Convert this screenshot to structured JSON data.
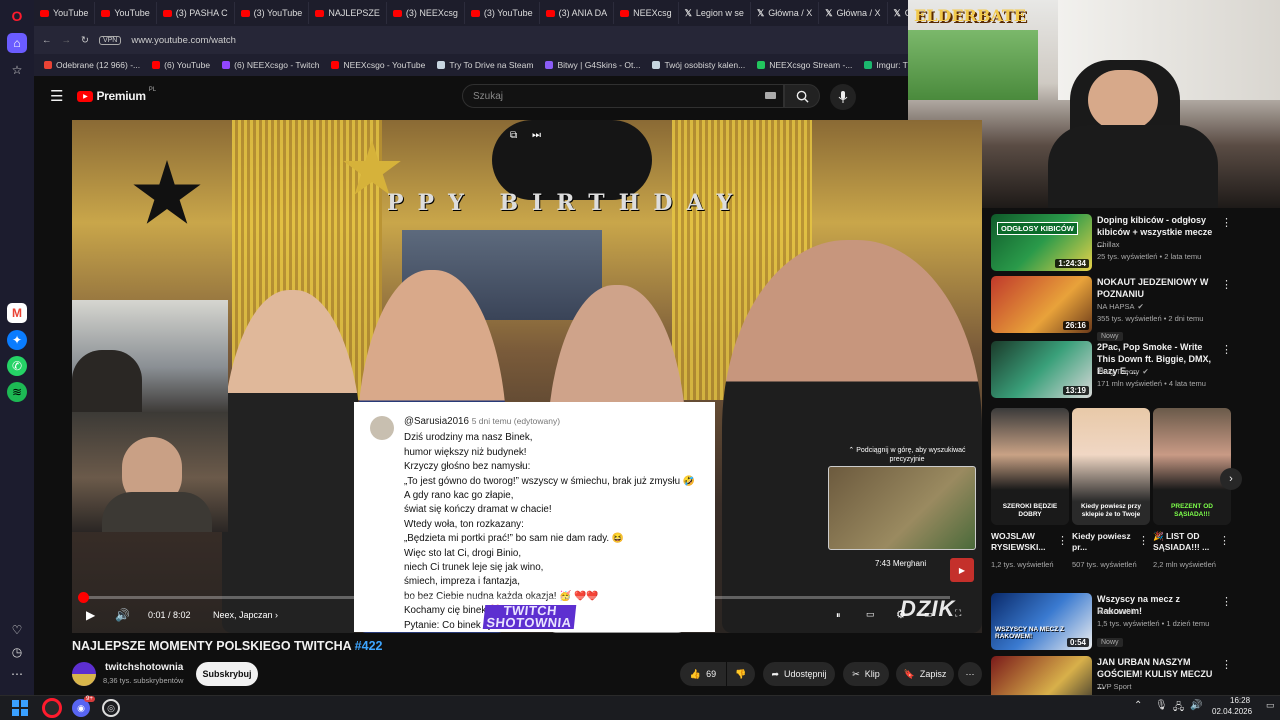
{
  "browser": {
    "tabs": [
      {
        "label": "YouTube",
        "kind": "yt"
      },
      {
        "label": "YouTube",
        "kind": "yt"
      },
      {
        "label": "(3) PASHA C",
        "kind": "yt"
      },
      {
        "label": "(3) YouTube",
        "kind": "yt"
      },
      {
        "label": "NAJLEPSZE",
        "kind": "yt"
      },
      {
        "label": "(3) NEEXcsg",
        "kind": "yt"
      },
      {
        "label": "(3) YouTube",
        "kind": "yt"
      },
      {
        "label": "(3) ANIA DA",
        "kind": "yt"
      },
      {
        "label": "NEEXcsg",
        "kind": "yt"
      },
      {
        "label": "Legion w se",
        "kind": "x"
      },
      {
        "label": "Główna / X",
        "kind": "x"
      },
      {
        "label": "Główna / X",
        "kind": "x"
      },
      {
        "label": "Główna / X",
        "kind": "x"
      }
    ],
    "vpn_label": "VPN",
    "url": "www.youtube.com/watch",
    "bookmarks": [
      {
        "label": "Odebrane (12 966) -...",
        "color": "#ea4335"
      },
      {
        "label": "(6) YouTube",
        "color": "#ff0000"
      },
      {
        "label": "(6) NEEXcsgo - Twitch",
        "color": "#9146ff"
      },
      {
        "label": "NEEXcsgo - YouTube",
        "color": "#ff0000"
      },
      {
        "label": "Try To Drive na Steam",
        "color": "#c7d5e0"
      },
      {
        "label": "Bitwy | G4Skins - Ot...",
        "color": "#8a5cf6"
      },
      {
        "label": "Twój osobisty kalen...",
        "color": "#c7d5e0"
      },
      {
        "label": "NEEXcsgo Stream -...",
        "color": "#22c55e"
      },
      {
        "label": "Imgur: The magic of...",
        "color": "#1bb76e"
      }
    ]
  },
  "header": {
    "logo": "Premium",
    "logo_sup": "PL",
    "search_placeholder": "Szukaj"
  },
  "video": {
    "banner": "PPY  BIRTHDAY",
    "comment": {
      "username": "@Sarusia2016",
      "date": "5 dni temu (edytowany)",
      "lines": [
        "Dziś urodziny ma nasz Binek,",
        "humor większy niż budynek!",
        "Krzyczy głośno bez namysłu:",
        "„To jest gówno do tworog!” wszyscy w śmiechu, brak już zmysłu 🤣",
        "A gdy rano kac go złapie,",
        "świat się kończy dramat w chacie!",
        "Wtedy woła, ton rozkazany:",
        "„Będzieta mi portki prać!” bo sam nie dam rady. 😆",
        "Więc sto lat Ci, drogi Binio,",
        "niech Ci trunek leje się jak wino,",
        "śmiech, impreza i fantazja,",
        "bo bez Ciebie nudna każda okazja! 🥳 ❤️❤️",
        "Kochamy cię binek ❤️",
        "Pytanie: Co binek zje na obiad ?"
      ]
    },
    "overlay_brand_1": "TWITCH",
    "overlay_brand_2": "SHOTOWNIA",
    "watermark": "DZIK",
    "seek_hint": "Podciągnij w górę, aby wyszukiwać precyzyjnie",
    "preview_time": "7:43",
    "preview_label": "Merghani",
    "time_current": "0:01",
    "time_total": "8:02",
    "chapter": "Neex, Japczan",
    "progress": 0.003
  },
  "meta": {
    "title": "NAJLEPSZE MOMENTY POLSKIEGO TWITCHA",
    "title_tag": "#422",
    "channel": "twitchshotownia",
    "subscribers": "8,36 tys. subskrybentów",
    "subscribe_label": "Subskrybuj",
    "likes": "69",
    "share_label": "Udostępnij",
    "clip_label": "Klip",
    "save_label": "Zapisz"
  },
  "recommendations": [
    {
      "title": "Doping kibiców - odgłosy kibiców + wszystkie mecze ...",
      "channel": "Chillax",
      "meta": "25 tys. wyświetleń • 2 lata temu",
      "duration": "1:24:34",
      "thumb_text": "ODGŁOSY KIBICÓW",
      "new": false,
      "verified": false
    },
    {
      "title": "NOKAUT JEDZENIOWY W POZNANIU",
      "channel": "NA HAPSA",
      "meta": "355 tys. wyświetleń • 2 dni temu",
      "duration": "26:16",
      "thumb_text": "",
      "new": true,
      "verified": true
    },
    {
      "title": "2Pac, Pop Smoke - Write This Down ft. Biggie, DMX, Eazy E, ...",
      "channel": "Thug Theory",
      "meta": "171 mln wyświetleń • 4 lata temu",
      "duration": "13:19",
      "thumb_text": "",
      "new": false,
      "verified": true
    }
  ],
  "shorts": [
    {
      "title": "WOJSLAW RYSIEWSKI...",
      "views": "1,2 tys. wyświetleń",
      "caption": "SZEROKI BĘDZIE DOBRY"
    },
    {
      "title": "Kiedy powiesz pr...",
      "views": "507 tys. wyświetleń",
      "caption": "Kiedy powiesz przy sklepie że to Twoje"
    },
    {
      "title": "🎉 LIST OD SĄSIADA!!! ...",
      "views": "2,2 mln wyświetleń",
      "caption": "PREZENT OD SĄSIADA!!!"
    }
  ],
  "recommendations_2": [
    {
      "title": "Wszyscy na mecz z Rakowem!",
      "channel": "Motor Lublin",
      "meta": "1,5 tys. wyświetleń • 1 dzień temu",
      "duration": "0:54",
      "thumb_text": "WSZYSCY NA MECZ Z RAKOWEM!",
      "new": true
    },
    {
      "title": "JAN URBAN NASZYM GOŚCIEM! KULISY MECZU ...",
      "channel": "TVP Sport",
      "meta": "",
      "duration": "",
      "thumb_text": "GOŚCIEM",
      "new": false
    }
  ],
  "stream_logo": "ELDERBATE",
  "taskbar": {
    "time": "16:28",
    "date": "02.04.2026",
    "discord_badge": "9+"
  }
}
